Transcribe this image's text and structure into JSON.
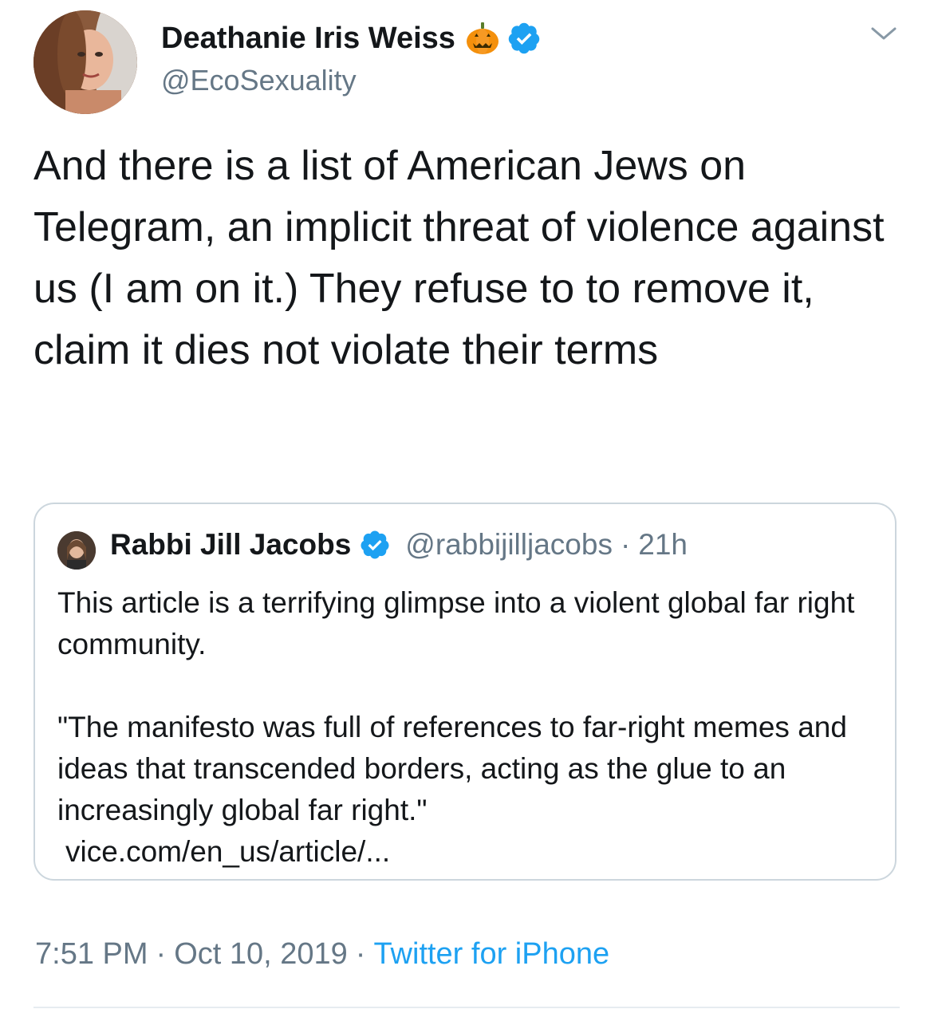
{
  "author": {
    "display_name": "Deathanie Iris Weiss",
    "handle": "@EcoSexuality",
    "emoji": "pumpkin-icon",
    "verified": true
  },
  "tweet": {
    "text": "And there is a list of American Jews on Telegram, an implicit threat of violence against us (I am on it.) They refuse to to remove it, claim it dies not violate their terms"
  },
  "quoted_tweet": {
    "display_name": "Rabbi Jill Jacobs",
    "verified": true,
    "handle": "@rabbijilljacobs",
    "separator": "·",
    "time_ago": "21h",
    "paragraph1": "This article is a terrifying glimpse into a violent global far right community.",
    "paragraph2": "\"The manifesto was full of references to far-right memes and ideas that transcended borders, acting as the glue to an increasingly global far right.\"",
    "link": "vice.com/en_us/article/..."
  },
  "meta": {
    "time": "7:51 PM",
    "separator": "·",
    "date": "Oct 10, 2019",
    "source": "Twitter for iPhone"
  },
  "colors": {
    "verified_blue": "#1da1f2",
    "secondary_text": "#657786",
    "border": "#ccd6dd"
  }
}
